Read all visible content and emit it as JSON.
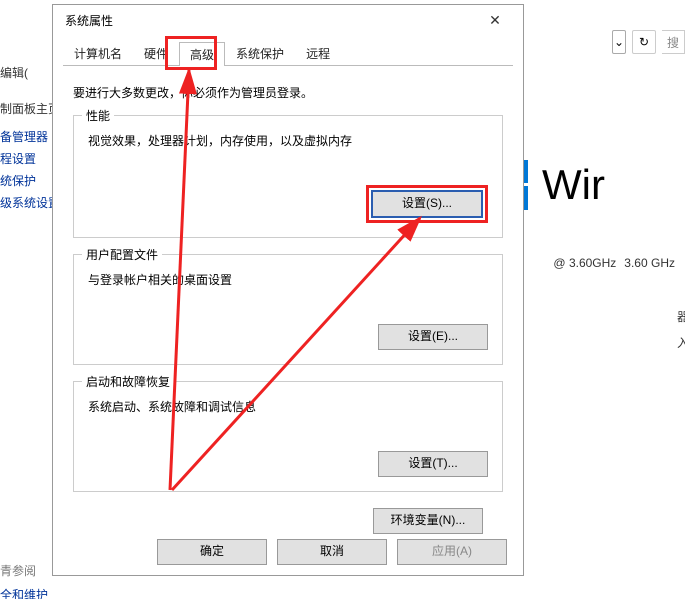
{
  "bg": {
    "editMenu": "编辑(",
    "refreshIcon": "↻",
    "searchPlaceholder": "搜",
    "links": {
      "home": "制面板主页",
      "devmgr": "备管理器",
      "remote": "程设置",
      "protect": "统保护",
      "advsys": "级系统设置",
      "seealso": "青参阅",
      "secmaint": "全和维护"
    },
    "winText": "Wir",
    "cpuLine": {
      "freq1": "@ 3.60GHz",
      "freq2": "3.60 GHz"
    },
    "spec1": "器",
    "spec2": "入"
  },
  "dialog": {
    "title": "系统属性",
    "closeGlyph": "✕",
    "tabs": {
      "computerName": "计算机名",
      "hardware": "硬件",
      "advanced": "高级",
      "systemProtect": "系统保护",
      "remote": "远程"
    },
    "hint": "要进行大多数更改，你必须作为管理员登录。",
    "perf": {
      "title": "性能",
      "desc": "视觉效果，处理器计划，内存使用，以及虚拟内存",
      "button": "设置(S)..."
    },
    "profile": {
      "title": "用户配置文件",
      "desc": "与登录帐户相关的桌面设置",
      "button": "设置(E)..."
    },
    "startup": {
      "title": "启动和故障恢复",
      "desc": "系统启动、系统故障和调试信息",
      "button": "设置(T)..."
    },
    "envButton": "环境变量(N)...",
    "footer": {
      "ok": "确定",
      "cancel": "取消",
      "apply": "应用(A)"
    }
  }
}
